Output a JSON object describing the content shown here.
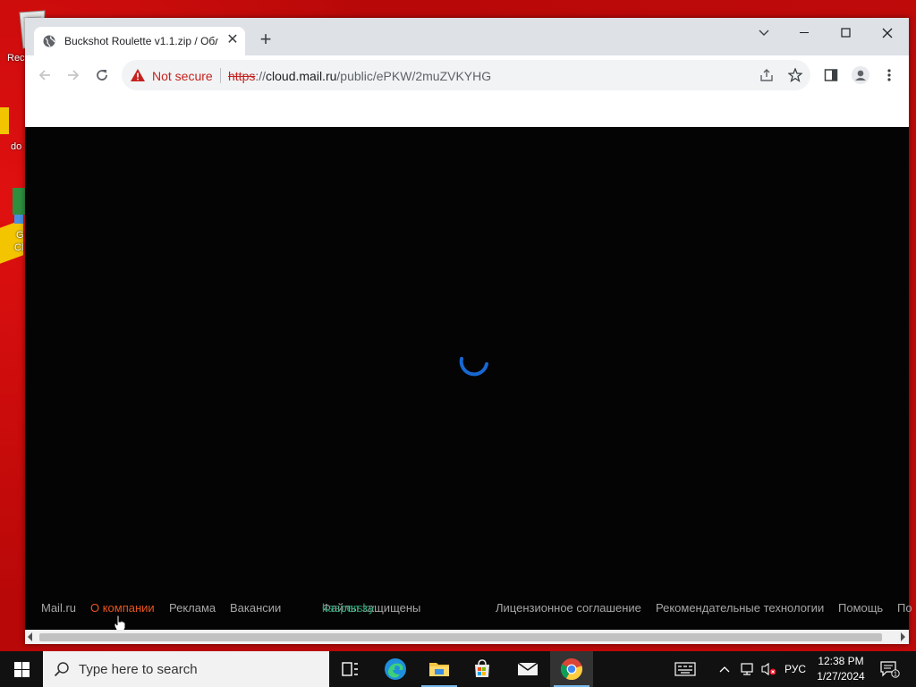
{
  "desktop": {
    "icons": [
      {
        "label": "Rec"
      },
      {
        "label": "do"
      },
      {
        "label": "G"
      },
      {
        "label": "Cl"
      }
    ]
  },
  "browser": {
    "tab": {
      "title": "Buckshot Roulette v1.1.zip / Обл"
    },
    "omnibox": {
      "security_label": "Not secure",
      "url_scheme": "https",
      "url_sep": "://",
      "url_host": "cloud.mail.ru",
      "url_path": "/public/ePKW/2muZVKYHG"
    }
  },
  "page": {
    "footer": {
      "mailru": "Mail.ru",
      "about": "О компании",
      "ads": "Реклама",
      "jobs": "Вакансии",
      "protected": "Файлы защищены",
      "kaspersky": "kaspersky",
      "license": "Лицензионное соглашение",
      "tech": "Рекомендательные технологии",
      "help": "Помощь",
      "more": "По"
    },
    "colors": {
      "spinner": "#1a73e8",
      "kaspersky": "#1f9f6f",
      "hover_link": "#e8541f"
    }
  },
  "taskbar": {
    "search_placeholder": "Type here to search",
    "language": "РУС",
    "time": "12:38 PM",
    "date": "1/27/2024",
    "notification_count": "1"
  }
}
